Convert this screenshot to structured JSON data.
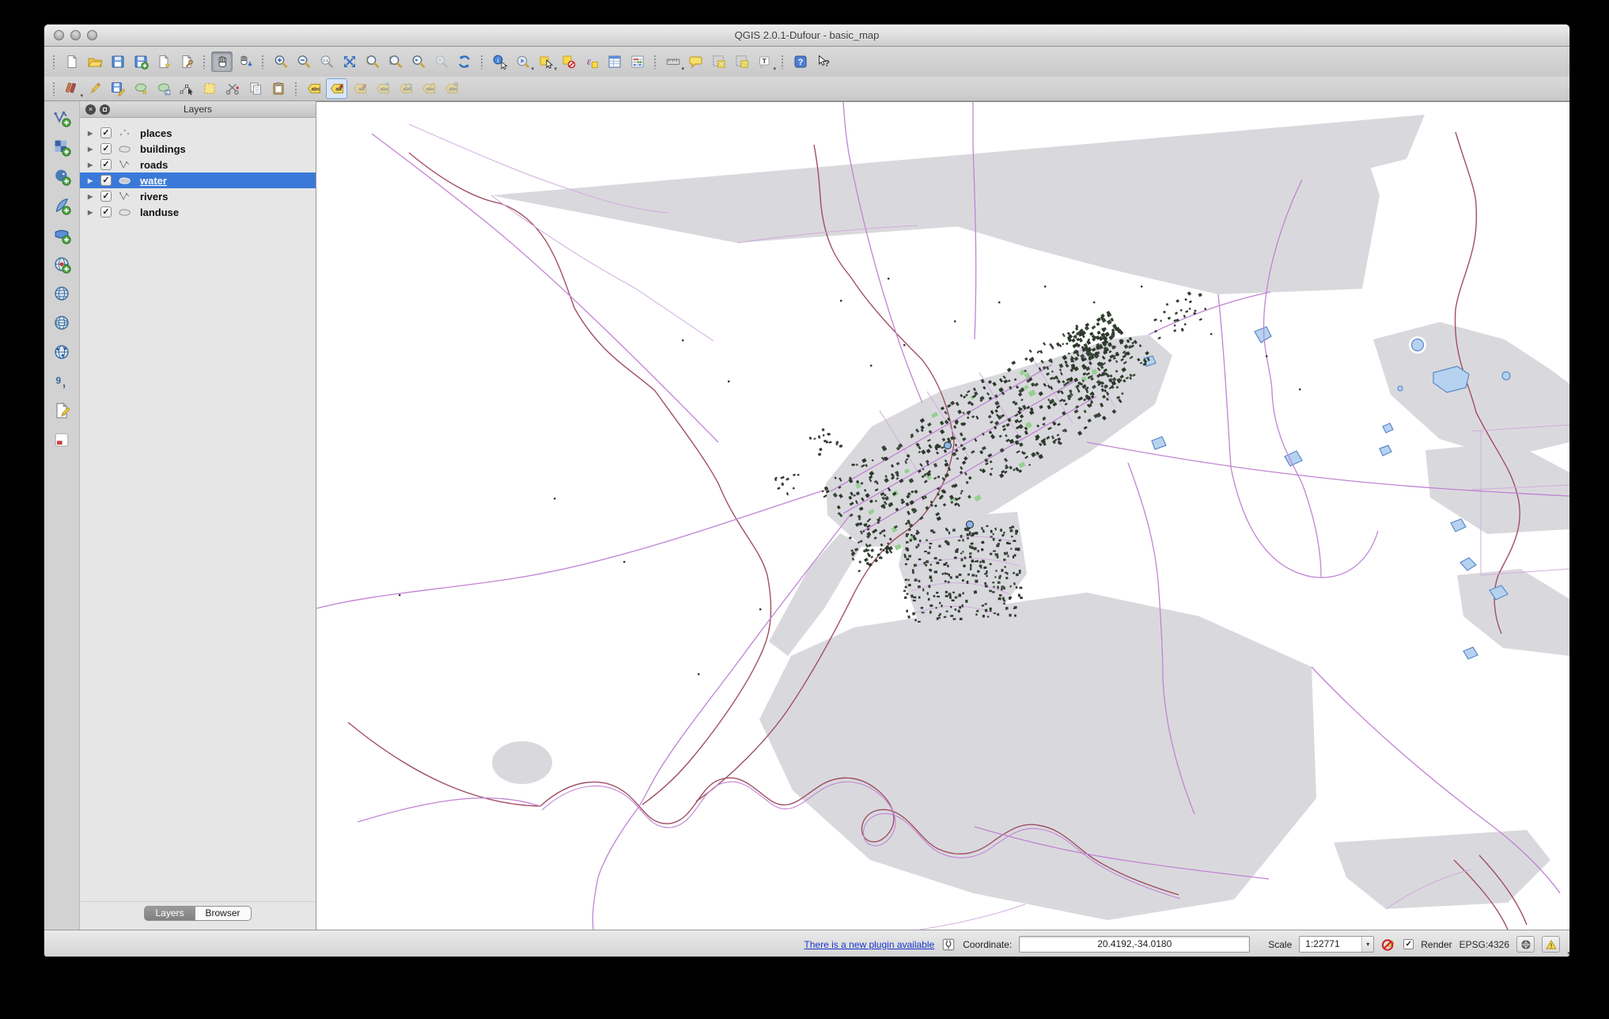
{
  "window": {
    "title": "QGIS 2.0.1-Dufour - basic_map"
  },
  "toolbars": {
    "main": [
      {
        "name": "new-project",
        "icon": "file-new-icon"
      },
      {
        "name": "open-project",
        "icon": "folder-open-icon"
      },
      {
        "name": "save-project",
        "icon": "save-icon"
      },
      {
        "name": "save-project-as",
        "icon": "save-as-icon"
      },
      {
        "name": "new-print-composer",
        "icon": "composer-new-icon"
      },
      {
        "name": "composer-manager",
        "icon": "composer-manager-icon",
        "group_end": true
      },
      {
        "name": "pan-map",
        "icon": "pan-hand-icon",
        "active": true
      },
      {
        "name": "pan-to-selection",
        "icon": "pan-selection-icon",
        "group_end": true
      },
      {
        "name": "zoom-in",
        "icon": "zoom-in-icon"
      },
      {
        "name": "zoom-out",
        "icon": "zoom-out-icon"
      },
      {
        "name": "zoom-native",
        "icon": "zoom-native-icon"
      },
      {
        "name": "zoom-full",
        "icon": "zoom-full-icon"
      },
      {
        "name": "zoom-to-selection",
        "icon": "zoom-selection-icon"
      },
      {
        "name": "zoom-to-layer",
        "icon": "zoom-layer-icon"
      },
      {
        "name": "zoom-last",
        "icon": "zoom-last-icon"
      },
      {
        "name": "zoom-next",
        "icon": "zoom-next-icon",
        "disabled": true
      },
      {
        "name": "refresh-map",
        "icon": "refresh-icon",
        "group_end": true
      },
      {
        "name": "identify-features",
        "icon": "identify-icon"
      },
      {
        "name": "run-feature-action",
        "icon": "feature-action-icon",
        "dropdown": true
      },
      {
        "name": "select-features",
        "icon": "select-rect-icon",
        "dropdown": true
      },
      {
        "name": "deselect-features",
        "icon": "deselect-icon"
      },
      {
        "name": "select-by-expression",
        "icon": "select-expression-icon"
      },
      {
        "name": "open-attribute-table",
        "icon": "attribute-table-icon"
      },
      {
        "name": "field-calculator",
        "icon": "field-calculator-icon",
        "group_end": true
      },
      {
        "name": "measure-line",
        "icon": "measure-icon",
        "dropdown": true
      },
      {
        "name": "map-tips",
        "icon": "map-tips-icon"
      },
      {
        "name": "new-bookmark",
        "icon": "bookmark-new-icon"
      },
      {
        "name": "show-bookmarks",
        "icon": "bookmark-show-icon"
      },
      {
        "name": "text-annotation",
        "icon": "annotation-icon",
        "dropdown": true,
        "group_end": true
      },
      {
        "name": "help-contents",
        "icon": "help-icon"
      },
      {
        "name": "whats-this",
        "icon": "whats-this-icon"
      }
    ],
    "digitizing": [
      {
        "name": "current-edits",
        "icon": "edits-current-icon",
        "dropdown": true
      },
      {
        "name": "toggle-editing",
        "icon": "edit-pencil-icon"
      },
      {
        "name": "save-layer-edits",
        "icon": "save-edits-icon"
      },
      {
        "name": "add-feature",
        "icon": "add-feature-icon"
      },
      {
        "name": "move-feature",
        "icon": "move-feature-icon"
      },
      {
        "name": "node-tool",
        "icon": "node-tool-icon"
      },
      {
        "name": "delete-selected",
        "icon": "delete-selected-icon"
      },
      {
        "name": "cut-features",
        "icon": "cut-icon"
      },
      {
        "name": "copy-features",
        "icon": "copy-icon"
      },
      {
        "name": "paste-features",
        "icon": "paste-icon",
        "group_end": true
      }
    ],
    "labels": [
      {
        "name": "labeling-options",
        "icon": "label-abc-icon"
      },
      {
        "name": "pin-unpin-labels",
        "icon": "label-pin-icon",
        "checked": true
      },
      {
        "name": "highlight-pinned-labels",
        "icon": "label-pin2-icon",
        "disabled": true
      },
      {
        "name": "move-label",
        "icon": "label-move-icon",
        "disabled": true
      },
      {
        "name": "rotate-label",
        "icon": "label-rotate-icon",
        "disabled": true
      },
      {
        "name": "change-label",
        "icon": "label-change-icon",
        "disabled": true
      },
      {
        "name": "label-properties",
        "icon": "label-props-icon",
        "disabled": true
      }
    ],
    "manage_layers": [
      {
        "name": "add-vector-layer",
        "icon": "vector-layer-icon"
      },
      {
        "name": "add-raster-layer",
        "icon": "raster-layer-icon"
      },
      {
        "name": "add-postgis-layer",
        "icon": "postgis-icon"
      },
      {
        "name": "add-spatialite-layer",
        "icon": "spatialite-icon"
      },
      {
        "name": "add-mssql-layer",
        "icon": "mssql-icon"
      },
      {
        "name": "add-oracle-layer",
        "icon": "oracle-icon"
      },
      {
        "name": "add-wms-layer",
        "icon": "wms-icon"
      },
      {
        "name": "add-wcs-layer",
        "icon": "wcs-icon"
      },
      {
        "name": "add-wfs-layer",
        "icon": "wfs-icon"
      },
      {
        "name": "add-delimited-text-layer",
        "icon": "delimited-text-icon"
      },
      {
        "name": "new-shapefile-layer",
        "icon": "new-shapefile-icon",
        "dropdown": true
      },
      {
        "name": "remove-layer",
        "icon": "remove-layer-icon"
      }
    ]
  },
  "layers_panel": {
    "title": "Layers",
    "items": [
      {
        "label": "places",
        "geometry": "point",
        "checked": true,
        "selected": false
      },
      {
        "label": "buildings",
        "geometry": "polygon",
        "checked": true,
        "selected": false
      },
      {
        "label": "roads",
        "geometry": "line",
        "checked": true,
        "selected": false
      },
      {
        "label": "water",
        "geometry": "polygon",
        "checked": true,
        "selected": true
      },
      {
        "label": "rivers",
        "geometry": "line",
        "checked": true,
        "selected": false
      },
      {
        "label": "landuse",
        "geometry": "polygon",
        "checked": true,
        "selected": false
      }
    ],
    "tabs": [
      {
        "label": "Layers",
        "active": true
      },
      {
        "label": "Browser",
        "active": false
      }
    ]
  },
  "statusbar": {
    "plugin_link": "There is a new plugin available",
    "coordinate_label": "Coordinate:",
    "coordinate_value": "20.4192,-34.0180",
    "scale_label": "Scale",
    "scale_value": "1:22771",
    "render_label": "Render",
    "crs_label": "EPSG:4326"
  },
  "map": {
    "colors": {
      "landuse": "#d9d9dd",
      "rivers": "#a04f62",
      "roads_major": "#c183d4",
      "roads_minor": "#d2abde",
      "water_fill": "#b5d3f0",
      "water_stroke": "#5b87c8",
      "buildings": "#2f3a2c",
      "buildings_green": "#97cf92",
      "selection_blue": "#3b79d8"
    }
  }
}
